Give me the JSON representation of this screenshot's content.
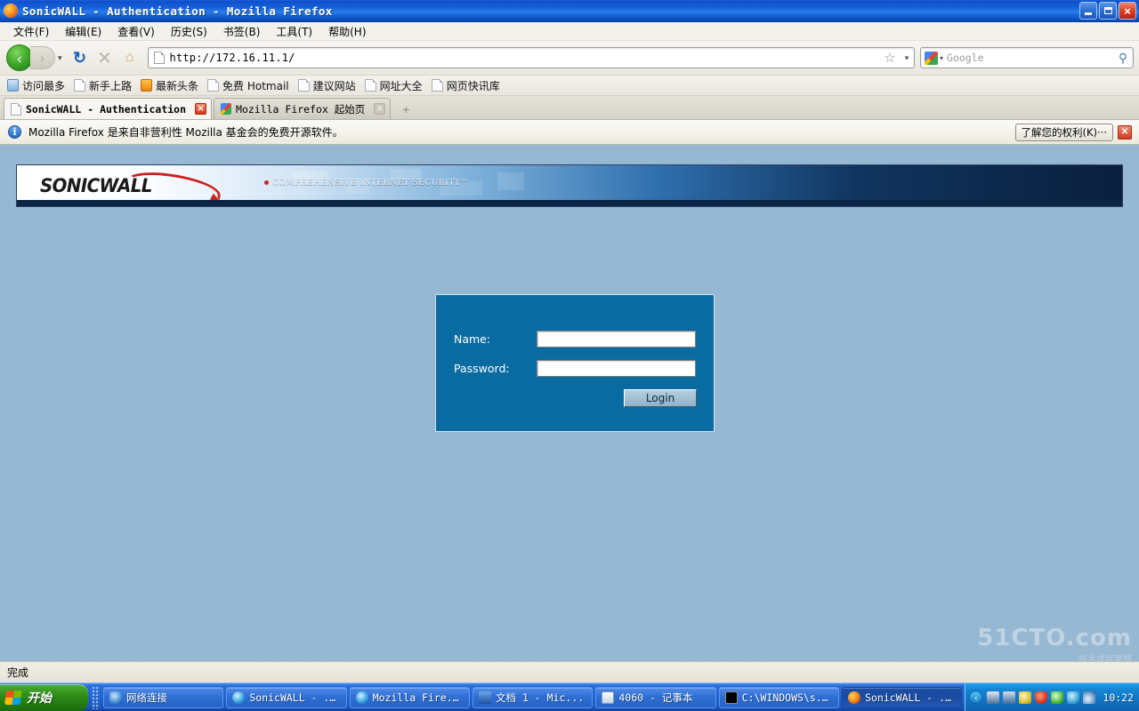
{
  "window": {
    "title": "SonicWALL - Authentication - Mozilla Firefox",
    "app_icon": "firefox-icon",
    "controls": {
      "minimize": "minimize-button",
      "maximize": "maximize-button",
      "close": "×"
    }
  },
  "menubar": {
    "items": [
      {
        "label": "文件(F)"
      },
      {
        "label": "编辑(E)"
      },
      {
        "label": "查看(V)"
      },
      {
        "label": "历史(S)"
      },
      {
        "label": "书签(B)"
      },
      {
        "label": "工具(T)"
      },
      {
        "label": "帮助(H)"
      }
    ]
  },
  "toolbar": {
    "back": "‹",
    "forward": "›",
    "history_dropdown": "▾",
    "reload": "↻",
    "stop": "✕",
    "home": "⌂",
    "url": "http://172.16.11.1/",
    "url_dropdown": "▾",
    "bookmark_star": "☆",
    "search": {
      "engine": "Google",
      "placeholder": "Google",
      "value": "",
      "dropdown": "▾",
      "magnifier": "⚲"
    }
  },
  "bookmarks": {
    "items": [
      {
        "label": "访问最多",
        "icon": "globe-icon"
      },
      {
        "label": "新手上路",
        "icon": "page-icon"
      },
      {
        "label": "最新头条",
        "icon": "rss-icon"
      },
      {
        "label": "免费 Hotmail",
        "icon": "page-icon"
      },
      {
        "label": "建议网站",
        "icon": "page-icon"
      },
      {
        "label": "网址大全",
        "icon": "page-icon"
      },
      {
        "label": "网页快讯库",
        "icon": "page-icon"
      }
    ]
  },
  "tabs": {
    "items": [
      {
        "label": "SonicWALL - Authentication",
        "icon": "page-icon",
        "active": true,
        "close": "✕"
      },
      {
        "label": "Mozilla Firefox 起始页",
        "icon": "google-icon",
        "active": false,
        "close": "✕"
      }
    ],
    "new_tab": "+"
  },
  "notification": {
    "icon": "info-icon",
    "message": "Mozilla Firefox 是来自非营利性 Mozilla 基金会的免费开源软件。",
    "action_label": "了解您的权利(K)···",
    "close": "✕"
  },
  "page": {
    "background_color": "#97b8d2",
    "banner": {
      "logo_text": "SONICWALL",
      "tagline": "COMPREHENSIVE INTERNET SECURITY",
      "tagline_tm": "™",
      "accent_color": "#cc2222"
    },
    "login": {
      "box_color": "#0a6ba0",
      "name_label": "Name:",
      "name_value": "",
      "password_label": "Password:",
      "password_value": "",
      "login_button": "Login"
    },
    "watermark": {
      "text": "51CTO.com",
      "sub": "技术成就梦想"
    }
  },
  "statusbar": {
    "text": "完成"
  },
  "taskbar": {
    "start_label": "开始",
    "tasks": [
      {
        "label": "网络连接",
        "icon": "network-icon",
        "active": false
      },
      {
        "label": "SonicWALL - ...",
        "icon": "ie-icon",
        "active": false
      },
      {
        "label": "Mozilla Fire...",
        "icon": "ie-icon",
        "active": false
      },
      {
        "label": "文档 1 - Mic...",
        "icon": "word-icon",
        "active": false
      },
      {
        "label": "4060 - 记事本",
        "icon": "notepad-icon",
        "active": false
      },
      {
        "label": "C:\\WINDOWS\\s...",
        "icon": "cmd-icon",
        "active": false
      },
      {
        "label": "SonicWALL - ...",
        "icon": "firefox-icon",
        "active": true
      }
    ],
    "tray": {
      "chevron": "‹",
      "icons": [
        "network-tray-icon",
        "volume-tray-icon",
        "update-tray-icon",
        "shield-tray-icon",
        "safe-tray-icon",
        "plant-tray-icon",
        "wireless-tray-icon"
      ],
      "clock": "10:22"
    }
  }
}
